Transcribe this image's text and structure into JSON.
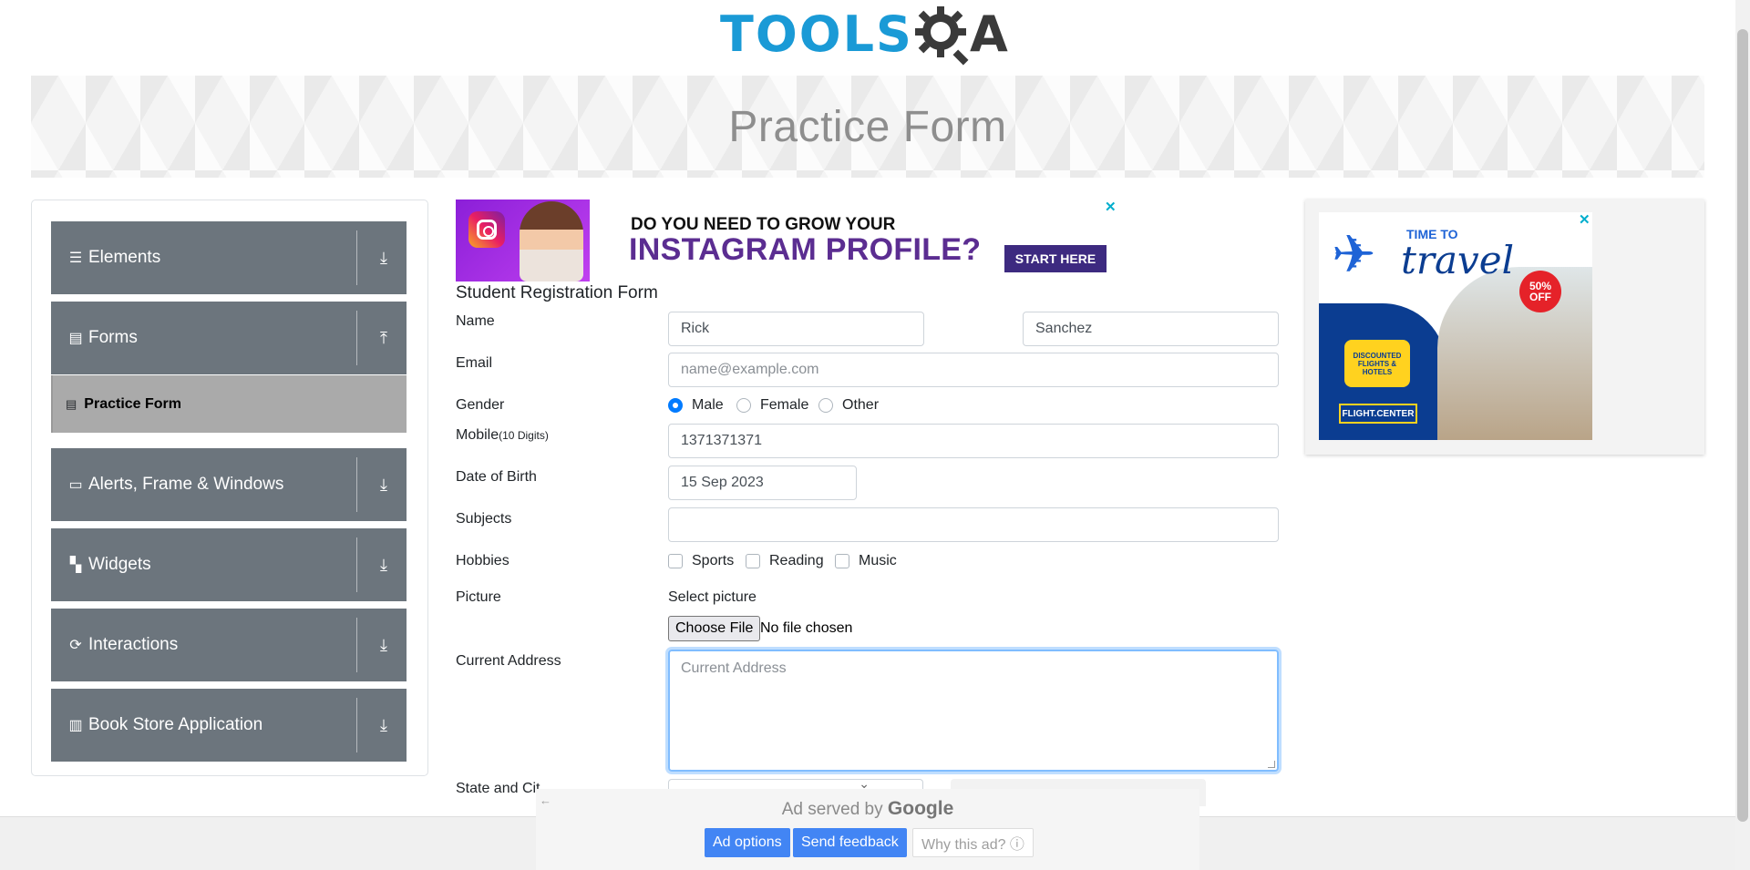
{
  "header": {
    "logo_tools": "TOOLS",
    "logo_a": "A",
    "page_title": "Practice Form"
  },
  "sidebar": {
    "groups": [
      {
        "label": "Elements",
        "icon": "hamburger-icon",
        "arrow": "download-arrow-icon"
      },
      {
        "label": "Forms",
        "icon": "document-icon",
        "arrow": "upload-arrow-icon"
      },
      {
        "label": "Alerts, Frame & Windows",
        "icon": "window-icon",
        "arrow": "download-arrow-icon"
      },
      {
        "label": "Widgets",
        "icon": "widgets-icon",
        "arrow": "download-arrow-icon"
      },
      {
        "label": "Interactions",
        "icon": "interactions-icon",
        "arrow": "download-arrow-icon"
      },
      {
        "label": "Book Store Application",
        "icon": "books-icon",
        "arrow": "download-arrow-icon"
      }
    ],
    "active_item": {
      "label": "Practice Form",
      "icon": "form-icon"
    }
  },
  "ad_top": {
    "line1": "DO YOU NEED TO GROW YOUR",
    "line2": "INSTAGRAM PROFILE?",
    "button": "START HERE",
    "close": "✕"
  },
  "form": {
    "title": "Student Registration Form",
    "name_label": "Name",
    "first_name": "Rick",
    "last_name": "Sanchez",
    "email_label": "Email",
    "email_placeholder": "name@example.com",
    "gender_label": "Gender",
    "gender_options": [
      "Male",
      "Female",
      "Other"
    ],
    "gender_selected": "Male",
    "mobile_label": "Mobile",
    "mobile_hint": "(10 Digits)",
    "mobile_value": "1371371371",
    "dob_label": "Date of Birth",
    "dob_value": "15 Sep 2023",
    "subjects_label": "Subjects",
    "hobbies_label": "Hobbies",
    "hobbies": [
      "Sports",
      "Reading",
      "Music"
    ],
    "picture_label": "Picture",
    "select_picture": "Select picture",
    "choose_file": "Choose File",
    "no_file": "No file chosen",
    "address_label": "Current Address",
    "address_placeholder": "Current Address",
    "state_label": "State and Cit"
  },
  "ad_right": {
    "time_to": "TIME TO",
    "travel": "travel",
    "discount": "50% OFF",
    "bubble": "DISCOUNTED FLIGHTS & HOTELS",
    "brand": "FLIGHT.CENTER",
    "close": "✕"
  },
  "google_ad": {
    "served_prefix": "Ad served by",
    "served_brand": "Google",
    "ad_options": "Ad options",
    "send_feedback": "Send feedback",
    "why_this_ad": "Why this ad? ⓘ",
    "back": "←"
  },
  "colors": {
    "sidebar_group": "#6c757d",
    "active_item": "#aaaaaa",
    "primary": "#007bff",
    "logo_blue": "#1a9ad6"
  }
}
